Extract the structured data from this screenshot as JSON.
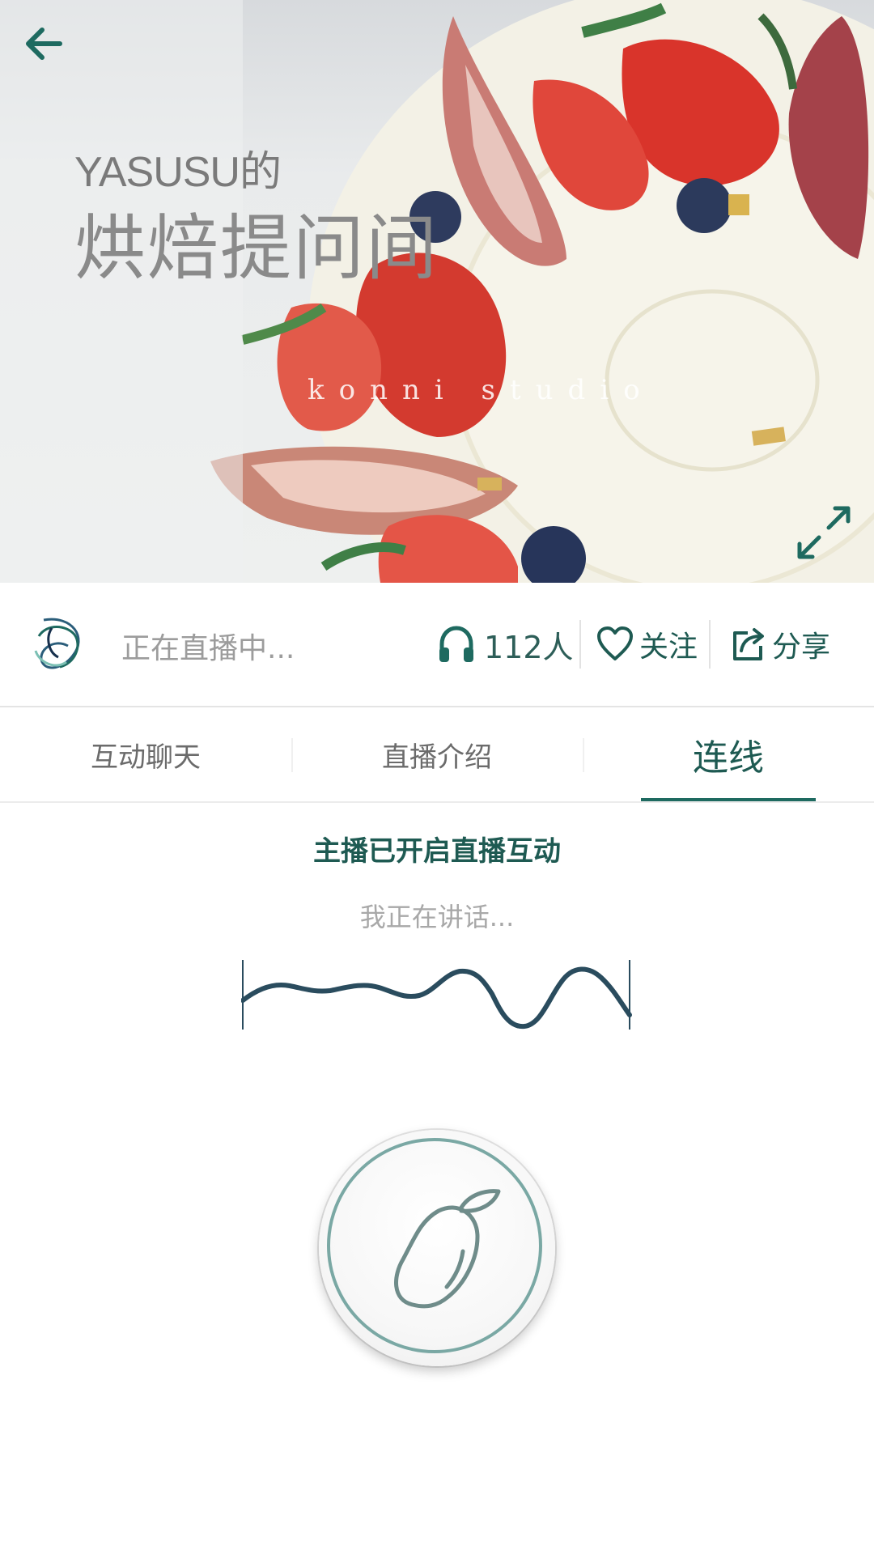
{
  "hero": {
    "subtitle": "YASUSU的",
    "title": "烘焙提问间",
    "watermark": "konni studio",
    "back_icon": "arrow-left-icon",
    "expand_icon": "expand-icon"
  },
  "info_bar": {
    "status": "正在直播中...",
    "listeners_icon": "headphones-icon",
    "listeners": "112人",
    "follow_icon": "heart-icon",
    "follow_label": "关注",
    "share_icon": "share-icon",
    "share_label": "分享"
  },
  "tabs": [
    {
      "label": "互动聊天",
      "active": false
    },
    {
      "label": "直播介绍",
      "active": false
    },
    {
      "label": "连线",
      "active": true
    }
  ],
  "interaction": {
    "notice": "主播已开启直播互动",
    "speaking": "我正在讲话...",
    "mic_icon": "mango-icon"
  },
  "colors": {
    "accent": "#1e5a52",
    "accent_light": "#7aa8a4",
    "muted_text": "#a8a8a8"
  }
}
